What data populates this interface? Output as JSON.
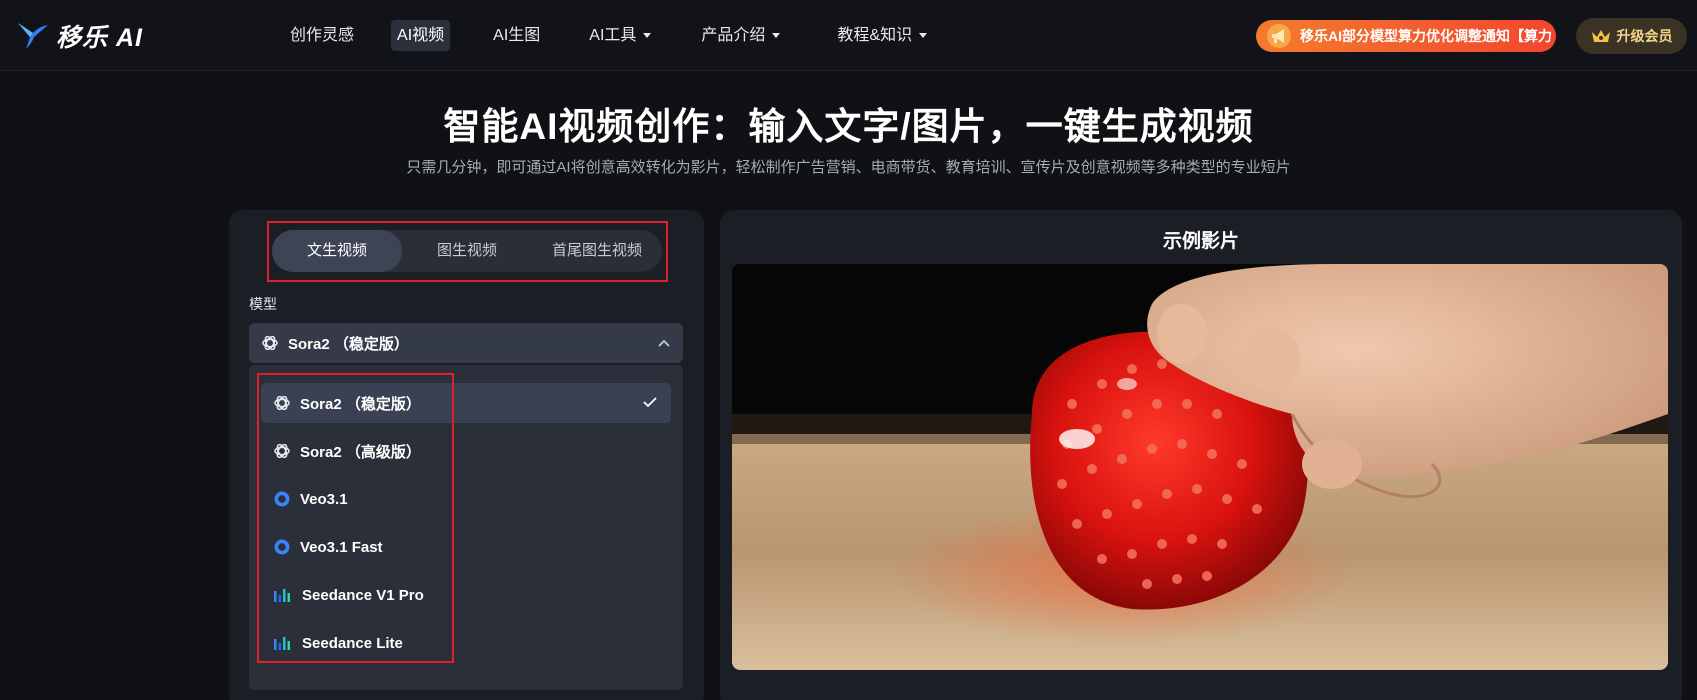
{
  "brand": {
    "name": "移乐 AI",
    "logo_icon": "swallow-bird-logo",
    "accent": "#2f7cf6"
  },
  "nav": {
    "items": [
      {
        "label": "创作灵感",
        "has_caret": false,
        "active": false
      },
      {
        "label": "AI视频",
        "has_caret": false,
        "active": true
      },
      {
        "label": "AI生图",
        "has_caret": false,
        "active": false
      },
      {
        "label": "AI工具",
        "has_caret": true,
        "active": false
      },
      {
        "label": "产品介绍",
        "has_caret": true,
        "active": false
      },
      {
        "label": "教程&知识",
        "has_caret": true,
        "active": false
      }
    ]
  },
  "notice": {
    "icon": "megaphone-icon",
    "text": "移乐AI部分模型算力优化调整通知【算力",
    "colors": [
      "#f37b2d",
      "#f2462f"
    ]
  },
  "vip": {
    "icon": "crown-icon",
    "label": "升级会员",
    "color": "#f4d488"
  },
  "hero": {
    "title": "智能AI视频创作：输入文字/图片，一键生成视频",
    "subtitle": "只需几分钟，即可通过AI将创意高效转化为影片，轻松制作广告营销、电商带货、教育培训、宣传片及创意视频等多种类型的专业短片"
  },
  "mode_tabs": [
    {
      "label": "文生视频",
      "active": true
    },
    {
      "label": "图生视频",
      "active": false
    },
    {
      "label": "首尾图生视频",
      "active": false
    }
  ],
  "model": {
    "label": "模型",
    "selected": "Sora2 （稳定版）",
    "selected_icon": "openai-icon",
    "expanded": true,
    "options": [
      {
        "label": "Sora2 （稳定版）",
        "icon": "openai-icon",
        "selected": true
      },
      {
        "label": "Sora2 （高级版）",
        "icon": "openai-icon",
        "selected": false
      },
      {
        "label": "Veo3.1",
        "icon": "veo-ring-icon",
        "selected": false
      },
      {
        "label": "Veo3.1 Fast",
        "icon": "veo-ring-icon",
        "selected": false
      },
      {
        "label": "Seedance V1 Pro",
        "icon": "seedance-bars-icon",
        "selected": false
      },
      {
        "label": "Seedance Lite",
        "icon": "seedance-bars-icon",
        "selected": false
      }
    ]
  },
  "preview": {
    "title": "示例影片",
    "media": "glass strawberry being cut on wooden board"
  },
  "highlight_color": "#e0202a"
}
